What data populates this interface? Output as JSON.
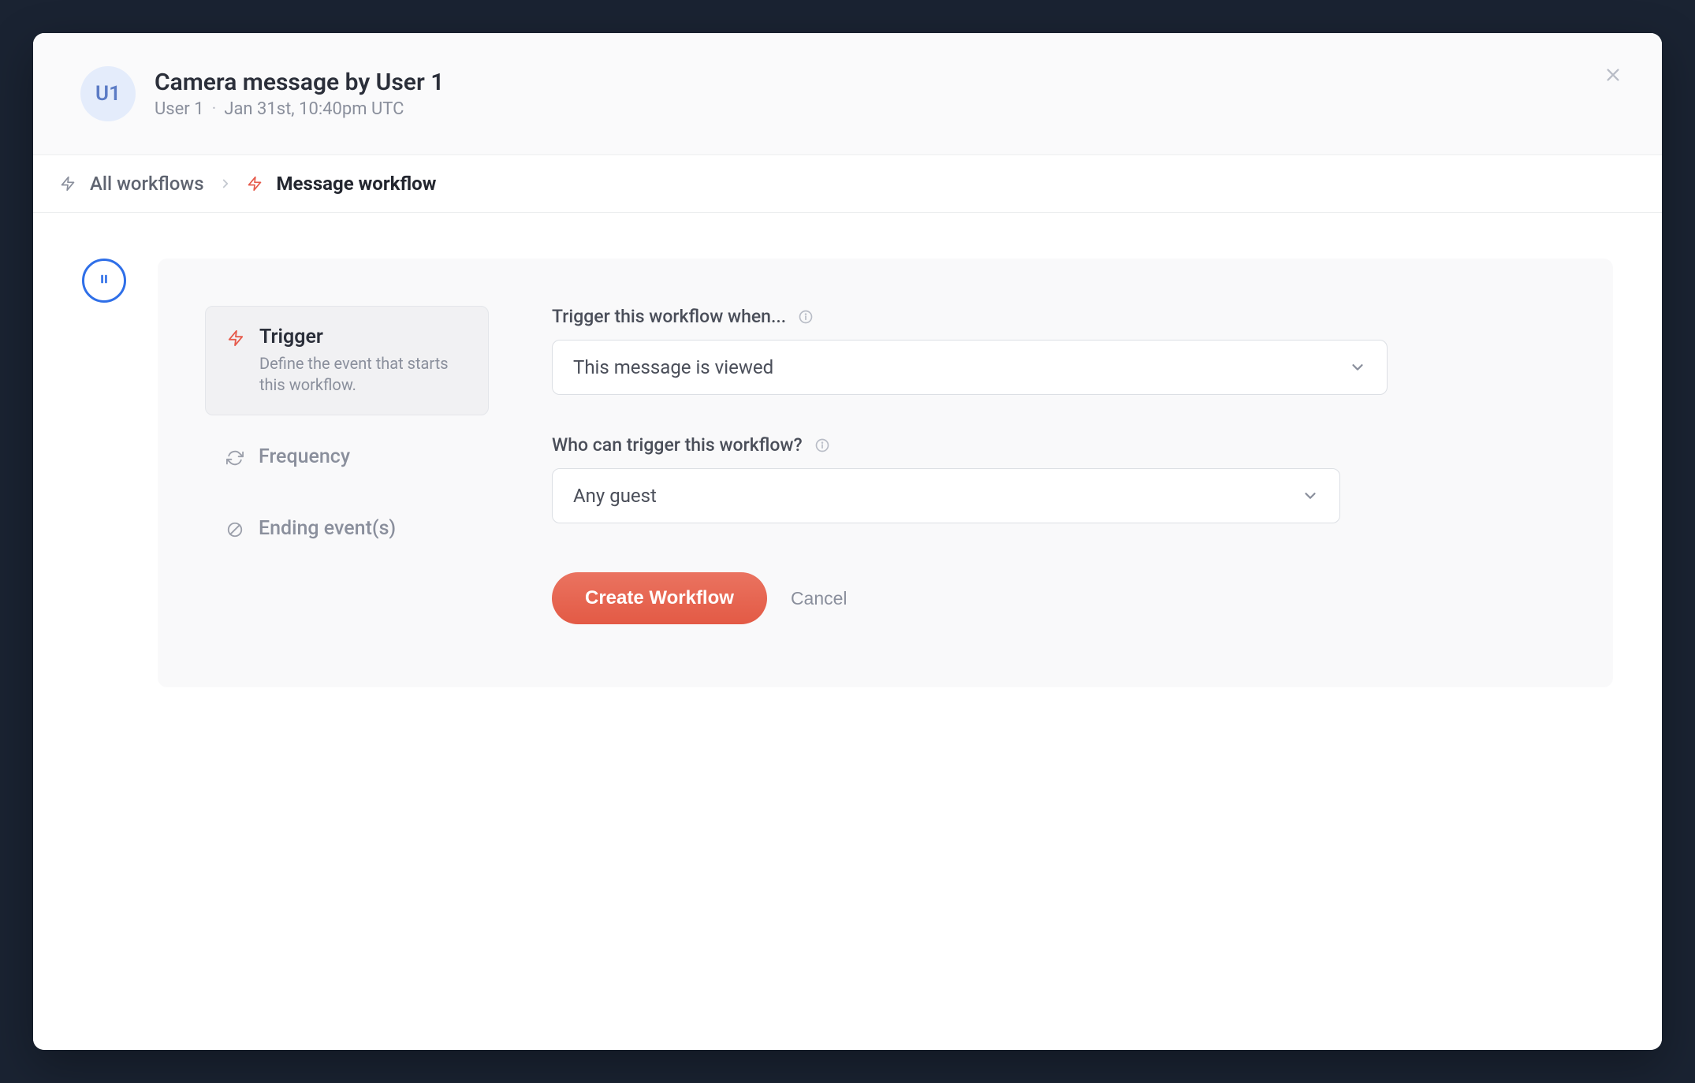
{
  "header": {
    "avatar_initials": "U1",
    "title": "Camera message by User 1",
    "author": "User 1",
    "separator": "·",
    "timestamp": "Jan 31st, 10:40pm UTC"
  },
  "breadcrumb": {
    "root": "All workflows",
    "current": "Message workflow"
  },
  "sidemenu": {
    "trigger": {
      "title": "Trigger",
      "desc": "Define the event that starts this workflow."
    },
    "frequency": {
      "title": "Frequency"
    },
    "ending": {
      "title": "Ending event(s)"
    }
  },
  "form": {
    "trigger_label": "Trigger this workflow when...",
    "trigger_value": "This message is viewed",
    "who_label": "Who can trigger this workflow?",
    "who_value": "Any guest"
  },
  "actions": {
    "create": "Create Workflow",
    "cancel": "Cancel"
  }
}
